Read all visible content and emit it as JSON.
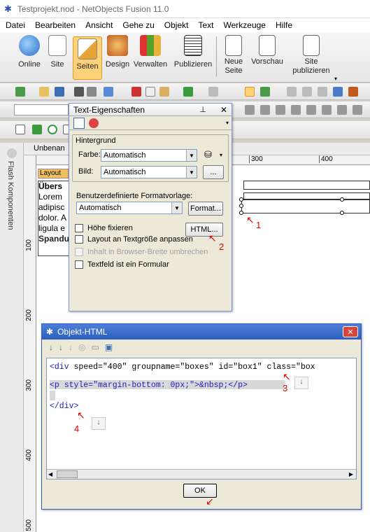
{
  "window": {
    "title": "Testprojekt.nod - NetObjects Fusion 11.0"
  },
  "menu": [
    "Datei",
    "Bearbeiten",
    "Ansicht",
    "Gehe zu",
    "Objekt",
    "Text",
    "Werkzeuge",
    "Hilfe"
  ],
  "ribbon": [
    {
      "label": "Online",
      "icon": "globe-icon",
      "color": "#3b8ad8"
    },
    {
      "label": "Site",
      "icon": "sitemap-icon",
      "color": "#4a9a4a"
    },
    {
      "label": "Seiten",
      "icon": "pencil-page-icon",
      "color": "#e8a23a"
    },
    {
      "label": "Design",
      "icon": "palette-icon",
      "color": "#c05a1f"
    },
    {
      "label": "Verwalten",
      "icon": "cubes-icon",
      "color": "#5aa02a"
    },
    {
      "label": "Publizieren",
      "icon": "documents-icon",
      "color": "#707070"
    },
    {
      "label": "Neue\nSeite",
      "icon": "new-page-icon",
      "color": "#3b6fb3"
    },
    {
      "label": "Vorschau",
      "icon": "preview-icon",
      "color": "#3b6fb3"
    },
    {
      "label": "Site\npublizieren",
      "icon": "publish-site-icon",
      "color": "#2a9a6a"
    }
  ],
  "sidebar": {
    "label": "Flash Komponenten"
  },
  "doc": {
    "tab": "Unbenan",
    "layout_tag": "Layout",
    "ruler_h": [
      "300",
      "400"
    ],
    "ruler_v": [
      "100",
      "200",
      "300",
      "400",
      "500"
    ],
    "text_lines": [
      "Übers",
      "Lorem",
      "adipisc",
      "dolor. A",
      "ligula e",
      "Spandu"
    ]
  },
  "text_props": {
    "title": "Text-Eigenschaften",
    "group_bg": "Hintergrund",
    "farbe_label": "Farbe:",
    "farbe_value": "Automatisch",
    "bild_label": "Bild:",
    "bild_value": "Automatisch",
    "bild_btn": "...",
    "format_label": "Benutzerdefinierte Formatvorlage:",
    "format_value": "Automatisch",
    "format_btn": "Format...",
    "html_btn": "HTML...",
    "checkboxes": [
      {
        "label": "Höhe fixieren",
        "enabled": true
      },
      {
        "label": "Layout an Textgröße anpassen",
        "enabled": true
      },
      {
        "label": "Inhalt in Browser-Breite umbrechen",
        "enabled": false
      },
      {
        "label": "Textfeld ist ein Formular",
        "enabled": true
      }
    ]
  },
  "object_html": {
    "title": "Objekt-HTML",
    "line1_tag": "<div",
    "line1_attrs": " speed=\"400\" groupname=\"boxes\" id=\"box1\" class=\"box",
    "line2": "<p style=\"margin-bottom: 0px;\">&nbsp;</p>",
    "line3": "</div>",
    "ok": "OK"
  },
  "annotations": [
    "1",
    "2",
    "3",
    "4"
  ]
}
